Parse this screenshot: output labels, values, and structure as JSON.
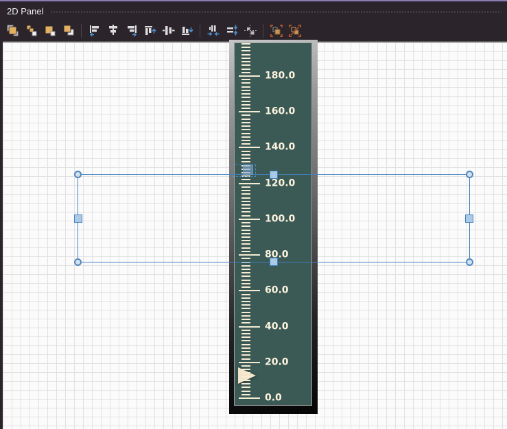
{
  "titlebar": {
    "title": "2D Panel",
    "accent_color": "#8A7DB3"
  },
  "toolbar": {
    "zorder_group": [
      "bring-to-front",
      "bring-forward",
      "send-backward",
      "send-to-back"
    ],
    "align_group": [
      "align-left",
      "align-center",
      "align-right",
      "align-top",
      "align-middle",
      "align-bottom"
    ],
    "spacing_group": [
      "make-horizontal-spacing-equal",
      "make-vertical-spacing-equal",
      "center-in-window"
    ],
    "grouping_group": [
      "group",
      "ungroup"
    ]
  },
  "canvas": {
    "background": "#FBFBFB",
    "grid_line_color": "#E1E1E1",
    "grid_size_px": 13
  },
  "meter": {
    "type": "linear-scale",
    "min": 0,
    "max": 198,
    "major_step": 20,
    "minor_step": 2,
    "major_labels": [
      "0.0",
      "20.0",
      "40.0",
      "60.0",
      "80.0",
      "100.0",
      "120.0",
      "140.0",
      "160.0",
      "180.0"
    ],
    "pointer": {
      "value": 12.5,
      "color": "#F3E5CA"
    },
    "face_color": "#3B5955",
    "tick_color": "#F6ECD4",
    "label_color": "#FCF4DF"
  },
  "selection": {
    "border_color": "#4281BE",
    "corner_handle_shape": "circle",
    "edge_handle_shape": "square",
    "handle_fill": "#CCDEF0"
  }
}
